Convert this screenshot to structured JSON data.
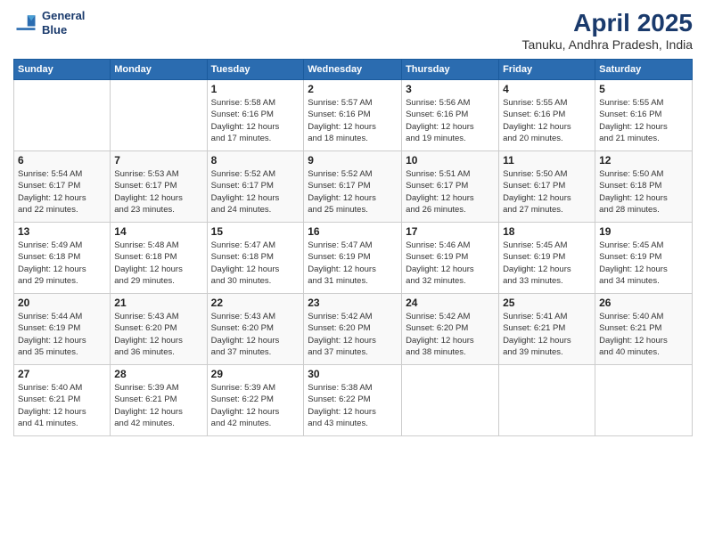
{
  "header": {
    "logo_line1": "General",
    "logo_line2": "Blue",
    "title": "April 2025",
    "subtitle": "Tanuku, Andhra Pradesh, India"
  },
  "days_of_week": [
    "Sunday",
    "Monday",
    "Tuesday",
    "Wednesday",
    "Thursday",
    "Friday",
    "Saturday"
  ],
  "weeks": [
    [
      {
        "day": "",
        "info": ""
      },
      {
        "day": "",
        "info": ""
      },
      {
        "day": "1",
        "info": "Sunrise: 5:58 AM\nSunset: 6:16 PM\nDaylight: 12 hours\nand 17 minutes."
      },
      {
        "day": "2",
        "info": "Sunrise: 5:57 AM\nSunset: 6:16 PM\nDaylight: 12 hours\nand 18 minutes."
      },
      {
        "day": "3",
        "info": "Sunrise: 5:56 AM\nSunset: 6:16 PM\nDaylight: 12 hours\nand 19 minutes."
      },
      {
        "day": "4",
        "info": "Sunrise: 5:55 AM\nSunset: 6:16 PM\nDaylight: 12 hours\nand 20 minutes."
      },
      {
        "day": "5",
        "info": "Sunrise: 5:55 AM\nSunset: 6:16 PM\nDaylight: 12 hours\nand 21 minutes."
      }
    ],
    [
      {
        "day": "6",
        "info": "Sunrise: 5:54 AM\nSunset: 6:17 PM\nDaylight: 12 hours\nand 22 minutes."
      },
      {
        "day": "7",
        "info": "Sunrise: 5:53 AM\nSunset: 6:17 PM\nDaylight: 12 hours\nand 23 minutes."
      },
      {
        "day": "8",
        "info": "Sunrise: 5:52 AM\nSunset: 6:17 PM\nDaylight: 12 hours\nand 24 minutes."
      },
      {
        "day": "9",
        "info": "Sunrise: 5:52 AM\nSunset: 6:17 PM\nDaylight: 12 hours\nand 25 minutes."
      },
      {
        "day": "10",
        "info": "Sunrise: 5:51 AM\nSunset: 6:17 PM\nDaylight: 12 hours\nand 26 minutes."
      },
      {
        "day": "11",
        "info": "Sunrise: 5:50 AM\nSunset: 6:17 PM\nDaylight: 12 hours\nand 27 minutes."
      },
      {
        "day": "12",
        "info": "Sunrise: 5:50 AM\nSunset: 6:18 PM\nDaylight: 12 hours\nand 28 minutes."
      }
    ],
    [
      {
        "day": "13",
        "info": "Sunrise: 5:49 AM\nSunset: 6:18 PM\nDaylight: 12 hours\nand 29 minutes."
      },
      {
        "day": "14",
        "info": "Sunrise: 5:48 AM\nSunset: 6:18 PM\nDaylight: 12 hours\nand 29 minutes."
      },
      {
        "day": "15",
        "info": "Sunrise: 5:47 AM\nSunset: 6:18 PM\nDaylight: 12 hours\nand 30 minutes."
      },
      {
        "day": "16",
        "info": "Sunrise: 5:47 AM\nSunset: 6:19 PM\nDaylight: 12 hours\nand 31 minutes."
      },
      {
        "day": "17",
        "info": "Sunrise: 5:46 AM\nSunset: 6:19 PM\nDaylight: 12 hours\nand 32 minutes."
      },
      {
        "day": "18",
        "info": "Sunrise: 5:45 AM\nSunset: 6:19 PM\nDaylight: 12 hours\nand 33 minutes."
      },
      {
        "day": "19",
        "info": "Sunrise: 5:45 AM\nSunset: 6:19 PM\nDaylight: 12 hours\nand 34 minutes."
      }
    ],
    [
      {
        "day": "20",
        "info": "Sunrise: 5:44 AM\nSunset: 6:19 PM\nDaylight: 12 hours\nand 35 minutes."
      },
      {
        "day": "21",
        "info": "Sunrise: 5:43 AM\nSunset: 6:20 PM\nDaylight: 12 hours\nand 36 minutes."
      },
      {
        "day": "22",
        "info": "Sunrise: 5:43 AM\nSunset: 6:20 PM\nDaylight: 12 hours\nand 37 minutes."
      },
      {
        "day": "23",
        "info": "Sunrise: 5:42 AM\nSunset: 6:20 PM\nDaylight: 12 hours\nand 37 minutes."
      },
      {
        "day": "24",
        "info": "Sunrise: 5:42 AM\nSunset: 6:20 PM\nDaylight: 12 hours\nand 38 minutes."
      },
      {
        "day": "25",
        "info": "Sunrise: 5:41 AM\nSunset: 6:21 PM\nDaylight: 12 hours\nand 39 minutes."
      },
      {
        "day": "26",
        "info": "Sunrise: 5:40 AM\nSunset: 6:21 PM\nDaylight: 12 hours\nand 40 minutes."
      }
    ],
    [
      {
        "day": "27",
        "info": "Sunrise: 5:40 AM\nSunset: 6:21 PM\nDaylight: 12 hours\nand 41 minutes."
      },
      {
        "day": "28",
        "info": "Sunrise: 5:39 AM\nSunset: 6:21 PM\nDaylight: 12 hours\nand 42 minutes."
      },
      {
        "day": "29",
        "info": "Sunrise: 5:39 AM\nSunset: 6:22 PM\nDaylight: 12 hours\nand 42 minutes."
      },
      {
        "day": "30",
        "info": "Sunrise: 5:38 AM\nSunset: 6:22 PM\nDaylight: 12 hours\nand 43 minutes."
      },
      {
        "day": "",
        "info": ""
      },
      {
        "day": "",
        "info": ""
      },
      {
        "day": "",
        "info": ""
      }
    ]
  ]
}
